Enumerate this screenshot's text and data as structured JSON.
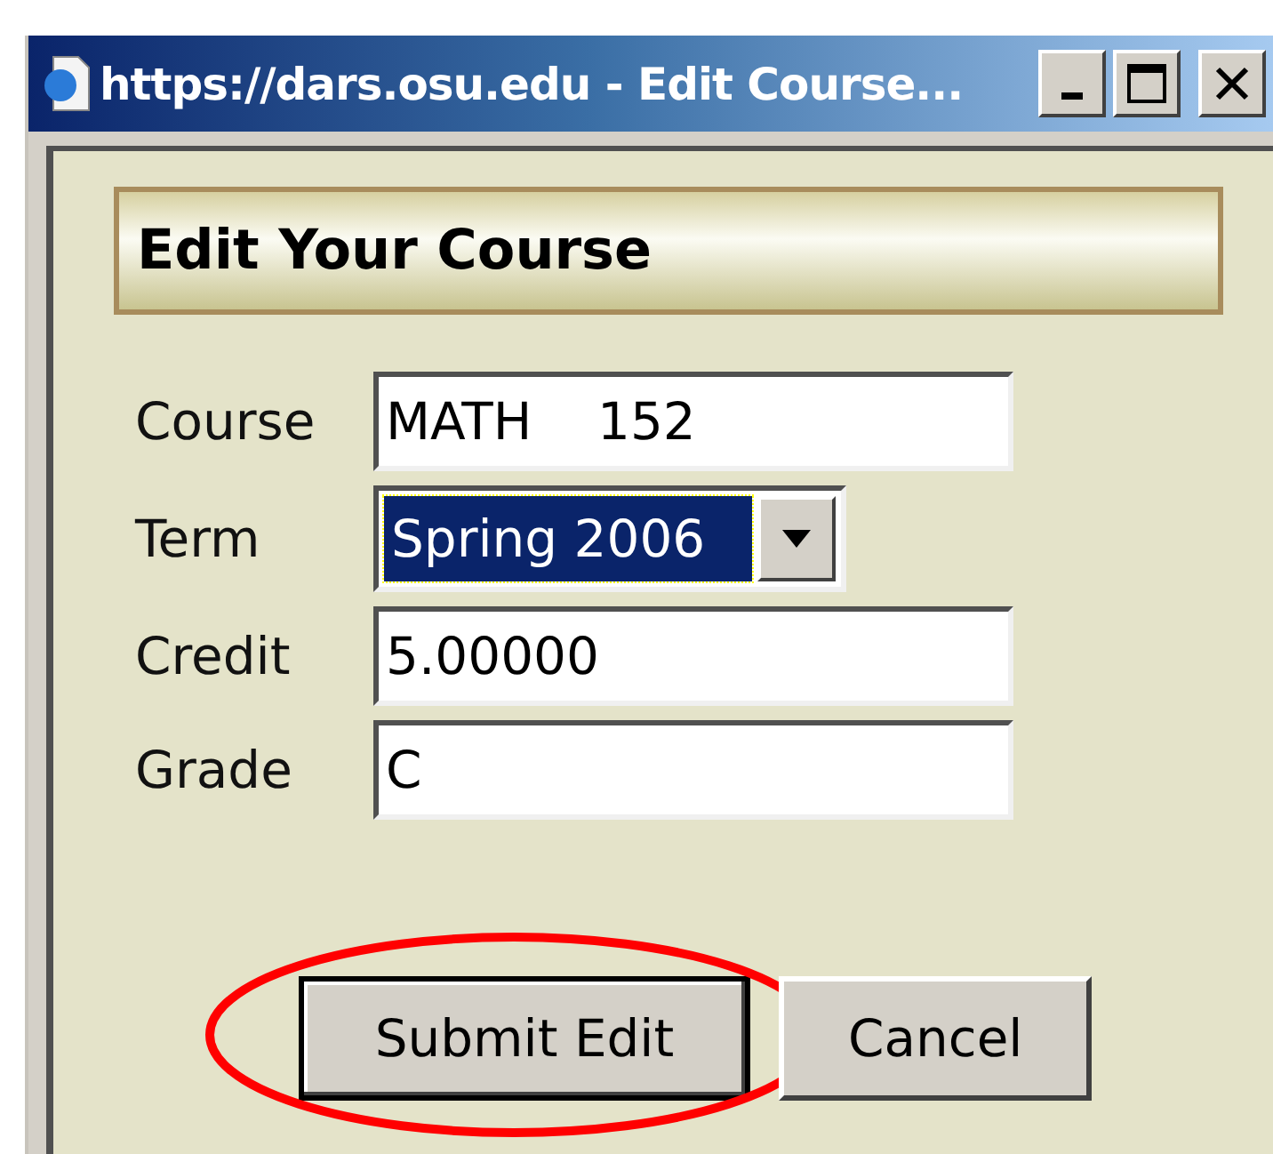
{
  "window": {
    "title": "https://dars.osu.edu - Edit Course..."
  },
  "header": {
    "title": "Edit Your Course"
  },
  "fields": [
    {
      "label": "Course",
      "kind": "text",
      "value": "MATH    152",
      "focused": false
    },
    {
      "label": "Term",
      "kind": "dropdown",
      "value": "Spring 2006",
      "focused": true
    },
    {
      "label": "Credit",
      "kind": "text",
      "value": "5.00000",
      "focused": false
    },
    {
      "label": "Grade",
      "kind": "text",
      "value": "C",
      "focused": false
    }
  ],
  "buttons": [
    {
      "label": "Submit Edit",
      "highlighted": true
    },
    {
      "label": "Cancel",
      "highlighted": false
    }
  ]
}
